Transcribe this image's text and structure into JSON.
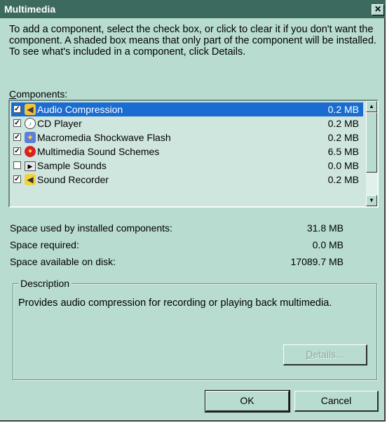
{
  "window": {
    "title": "Multimedia"
  },
  "intro_text": "To add a component, select the check box, or click to clear it if you don't want the component. A shaded box means that only part of the component will be installed. To see what's included in a component, click Details.",
  "components": {
    "label_prefix": "C",
    "label_rest": "omponents:",
    "items": [
      {
        "label": "Audio Compression",
        "size": "0.2 MB",
        "checked": "✓",
        "icon": "audio-compression-icon",
        "selected": true
      },
      {
        "label": "CD Player",
        "size": "0.2 MB",
        "checked": "✓",
        "icon": "cd-player-icon"
      },
      {
        "label": "Macromedia Shockwave Flash",
        "size": "0.2 MB",
        "checked": "✓",
        "icon": "shockwave-flash-icon"
      },
      {
        "label": "Multimedia Sound Schemes",
        "size": "6.5 MB",
        "checked": "✓",
        "icon": "sound-schemes-icon"
      },
      {
        "label": "Sample Sounds",
        "size": "0.0 MB",
        "checked": "",
        "icon": "sample-sounds-icon"
      },
      {
        "label": "Sound Recorder",
        "size": "0.2 MB",
        "checked": "✓",
        "icon": "sound-recorder-icon"
      }
    ]
  },
  "space": {
    "used_label": "Space used by installed components:",
    "used_value": "31.8 MB",
    "required_label": "Space required:",
    "required_value": "0.0 MB",
    "available_label": "Space available on disk:",
    "available_value": "17089.7 MB"
  },
  "description": {
    "title": "Description",
    "text": "Provides audio compression for recording or playing back multimedia."
  },
  "buttons": {
    "details_prefix": "D",
    "details_rest": "etails...",
    "ok": "OK",
    "cancel": "Cancel"
  },
  "colors": {
    "background": "#b8dcd0",
    "titlebar": "#3d6a5e",
    "selection": "#1a6cd0"
  }
}
